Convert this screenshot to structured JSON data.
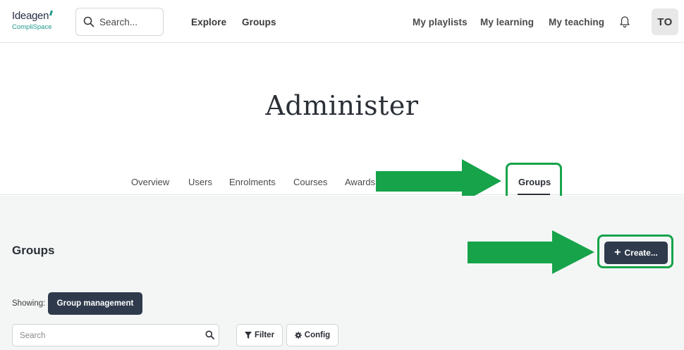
{
  "brand": {
    "name": "Ideagen",
    "product": "CompliSpace"
  },
  "search": {
    "placeholder": "Search..."
  },
  "nav": {
    "left": [
      {
        "label": "Explore"
      },
      {
        "label": "Groups"
      }
    ],
    "right": [
      {
        "label": "My playlists"
      },
      {
        "label": "My learning"
      },
      {
        "label": "My teaching"
      }
    ]
  },
  "user": {
    "initials": "TO"
  },
  "page": {
    "title": "Administer"
  },
  "tabs": [
    {
      "label": "Overview"
    },
    {
      "label": "Users"
    },
    {
      "label": "Enrolments"
    },
    {
      "label": "Courses"
    },
    {
      "label": "Awards"
    },
    {
      "label": "Groups"
    }
  ],
  "active_tab": "Groups",
  "section": {
    "title": "Groups",
    "create_label": "Create...",
    "showing_label": "Showing:",
    "showing_value": "Group management",
    "search_placeholder": "Search",
    "filter_label": "Filter",
    "config_label": "Config"
  },
  "colors": {
    "primary_dark": "#2f3b4c",
    "annotation_green": "#16a34a",
    "brand_teal": "#1f9a8a"
  },
  "icons": [
    "search-icon",
    "bell-icon",
    "plus-icon",
    "funnel-icon",
    "gear-icon",
    "arrow-right-icon"
  ]
}
